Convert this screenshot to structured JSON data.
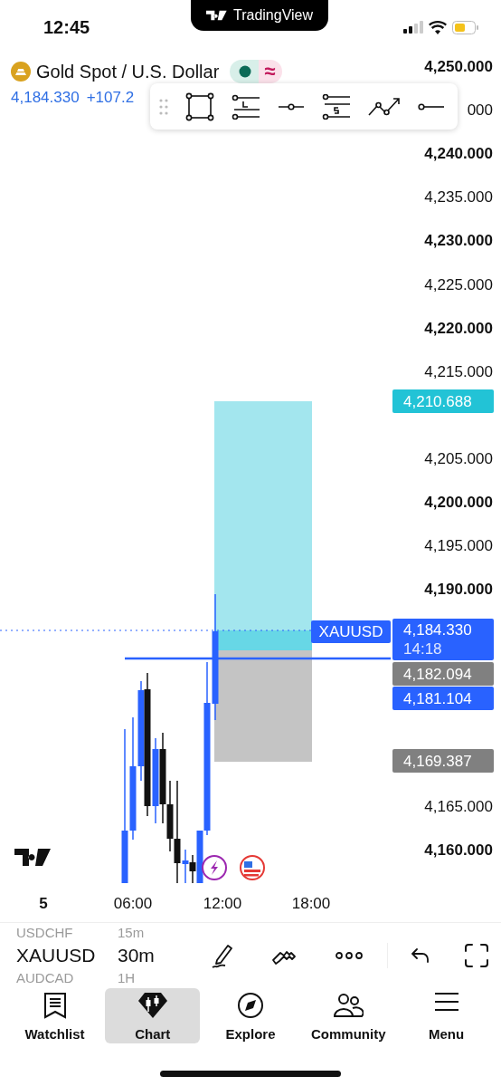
{
  "status_bar": {
    "time": "12:45",
    "banner": "TradingView"
  },
  "symbol": {
    "title": "Gold Spot / U.S. Dollar",
    "status_badge": "≈",
    "price": "4,184.330",
    "change": "+107.2"
  },
  "drawing_toolbar": {
    "tools": [
      {
        "kind": "rectangle"
      },
      {
        "kind": "long"
      },
      {
        "kind": "hline"
      },
      {
        "kind": "short"
      },
      {
        "kind": "path"
      },
      {
        "kind": "ray"
      }
    ]
  },
  "price_axis": {
    "labels": [
      {
        "text": "4,250.000",
        "kind": "major"
      },
      {
        "text": "000",
        "kind": "minor"
      },
      {
        "text": "4,240.000",
        "kind": "major"
      },
      {
        "text": "4,235.000",
        "kind": "minor"
      },
      {
        "text": "4,230.000",
        "kind": "major"
      },
      {
        "text": "4,225.000",
        "kind": "minor"
      },
      {
        "text": "4,220.000",
        "kind": "major"
      },
      {
        "text": "4,215.000",
        "kind": "minor"
      },
      {
        "text": "4,205.000",
        "kind": "minor"
      },
      {
        "text": "4,200.000",
        "kind": "major"
      },
      {
        "text": "4,195.000",
        "kind": "minor"
      },
      {
        "text": "4,190.000",
        "kind": "major"
      },
      {
        "text": "4,165.000",
        "kind": "minor"
      },
      {
        "text": "4,160.000",
        "kind": "major"
      }
    ],
    "tags": [
      {
        "text": "4,210.688",
        "color": "#22c3d6"
      },
      {
        "text": "4,184.330",
        "sub": "14:18",
        "color": "#2962ff"
      },
      {
        "text": "4,182.094",
        "color": "#808080"
      },
      {
        "text": "4,181.104",
        "color": "#2962ff"
      },
      {
        "text": "4,169.387",
        "color": "#808080"
      }
    ],
    "symbol_tag": "XAUUSD"
  },
  "time_axis": {
    "labels": [
      {
        "text": "5",
        "kind": "day"
      },
      {
        "text": "06:00",
        "kind": "time"
      },
      {
        "text": "12:00",
        "kind": "time"
      },
      {
        "text": "18:00",
        "kind": "time"
      }
    ]
  },
  "picker": {
    "rows": [
      {
        "symbol": "USDCHF",
        "interval": "15m",
        "selected": false
      },
      {
        "symbol": "XAUUSD",
        "interval": "30m",
        "selected": true
      },
      {
        "symbol": "AUDCAD",
        "interval": "1H",
        "selected": false
      }
    ]
  },
  "chart_toolbar": {
    "tools": [
      {
        "kind": "draw"
      },
      {
        "kind": "patterns"
      },
      {
        "kind": "more"
      },
      {
        "kind": "undo"
      },
      {
        "kind": "fullscreen"
      }
    ]
  },
  "tabs": [
    {
      "label": "Watchlist",
      "kind": "watchlist",
      "selected": false
    },
    {
      "label": "Chart",
      "kind": "chart",
      "selected": true
    },
    {
      "label": "Explore",
      "kind": "explore",
      "selected": false
    },
    {
      "label": "Community",
      "kind": "community",
      "selected": false
    },
    {
      "label": "Menu",
      "kind": "menu",
      "selected": false
    }
  ]
}
